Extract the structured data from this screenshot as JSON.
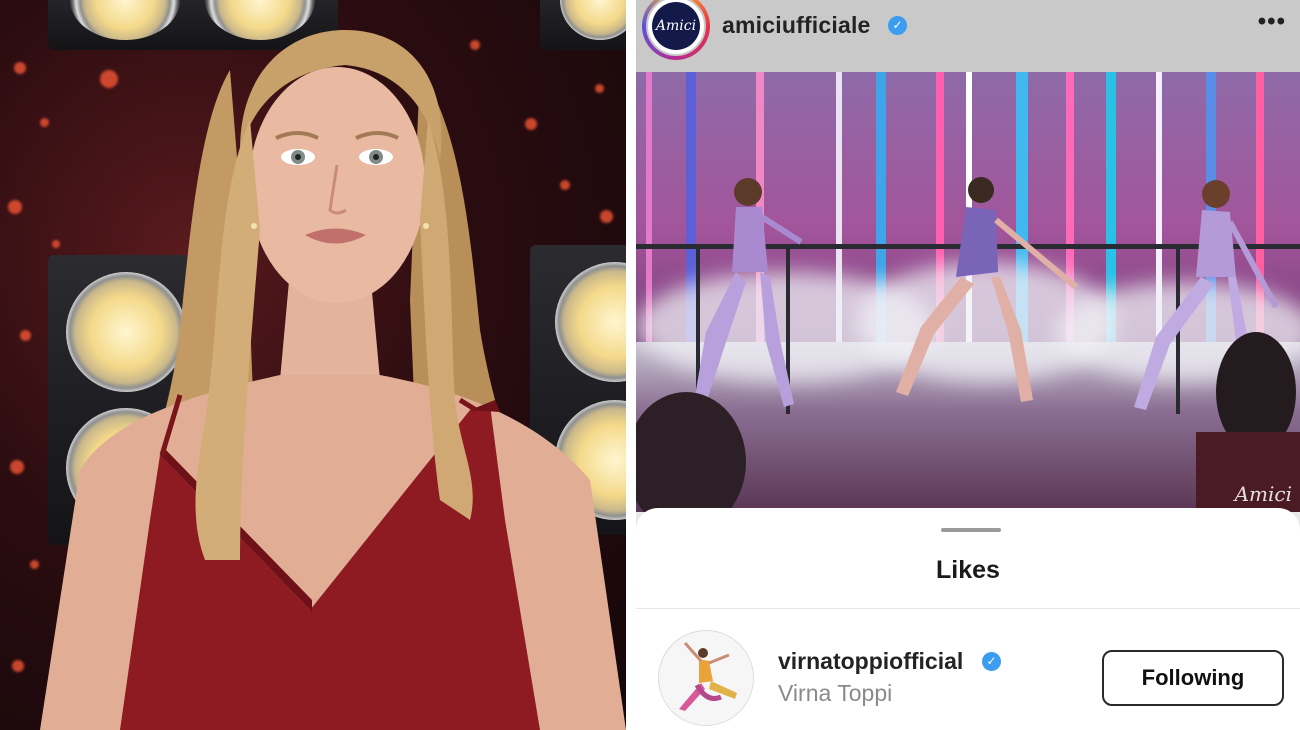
{
  "left_photo": {
    "description_icon": "portrait-photo",
    "dress_color": "#8e1a22",
    "background_color": "#2a0c10"
  },
  "instagram": {
    "header": {
      "username": "amiciufficiale",
      "avatar_text": "Amici",
      "verified_icon": "verified-badge-icon",
      "more_label": "•••"
    },
    "post": {
      "watermark": "Amici"
    },
    "likes_sheet": {
      "title": "Likes",
      "items": [
        {
          "username": "virnatoppiofficial",
          "full_name": "Virna Toppi",
          "button_label": "Following"
        }
      ]
    },
    "colors": {
      "verified": "#3b9cf0",
      "header_bg": "#c9c9c9"
    }
  }
}
